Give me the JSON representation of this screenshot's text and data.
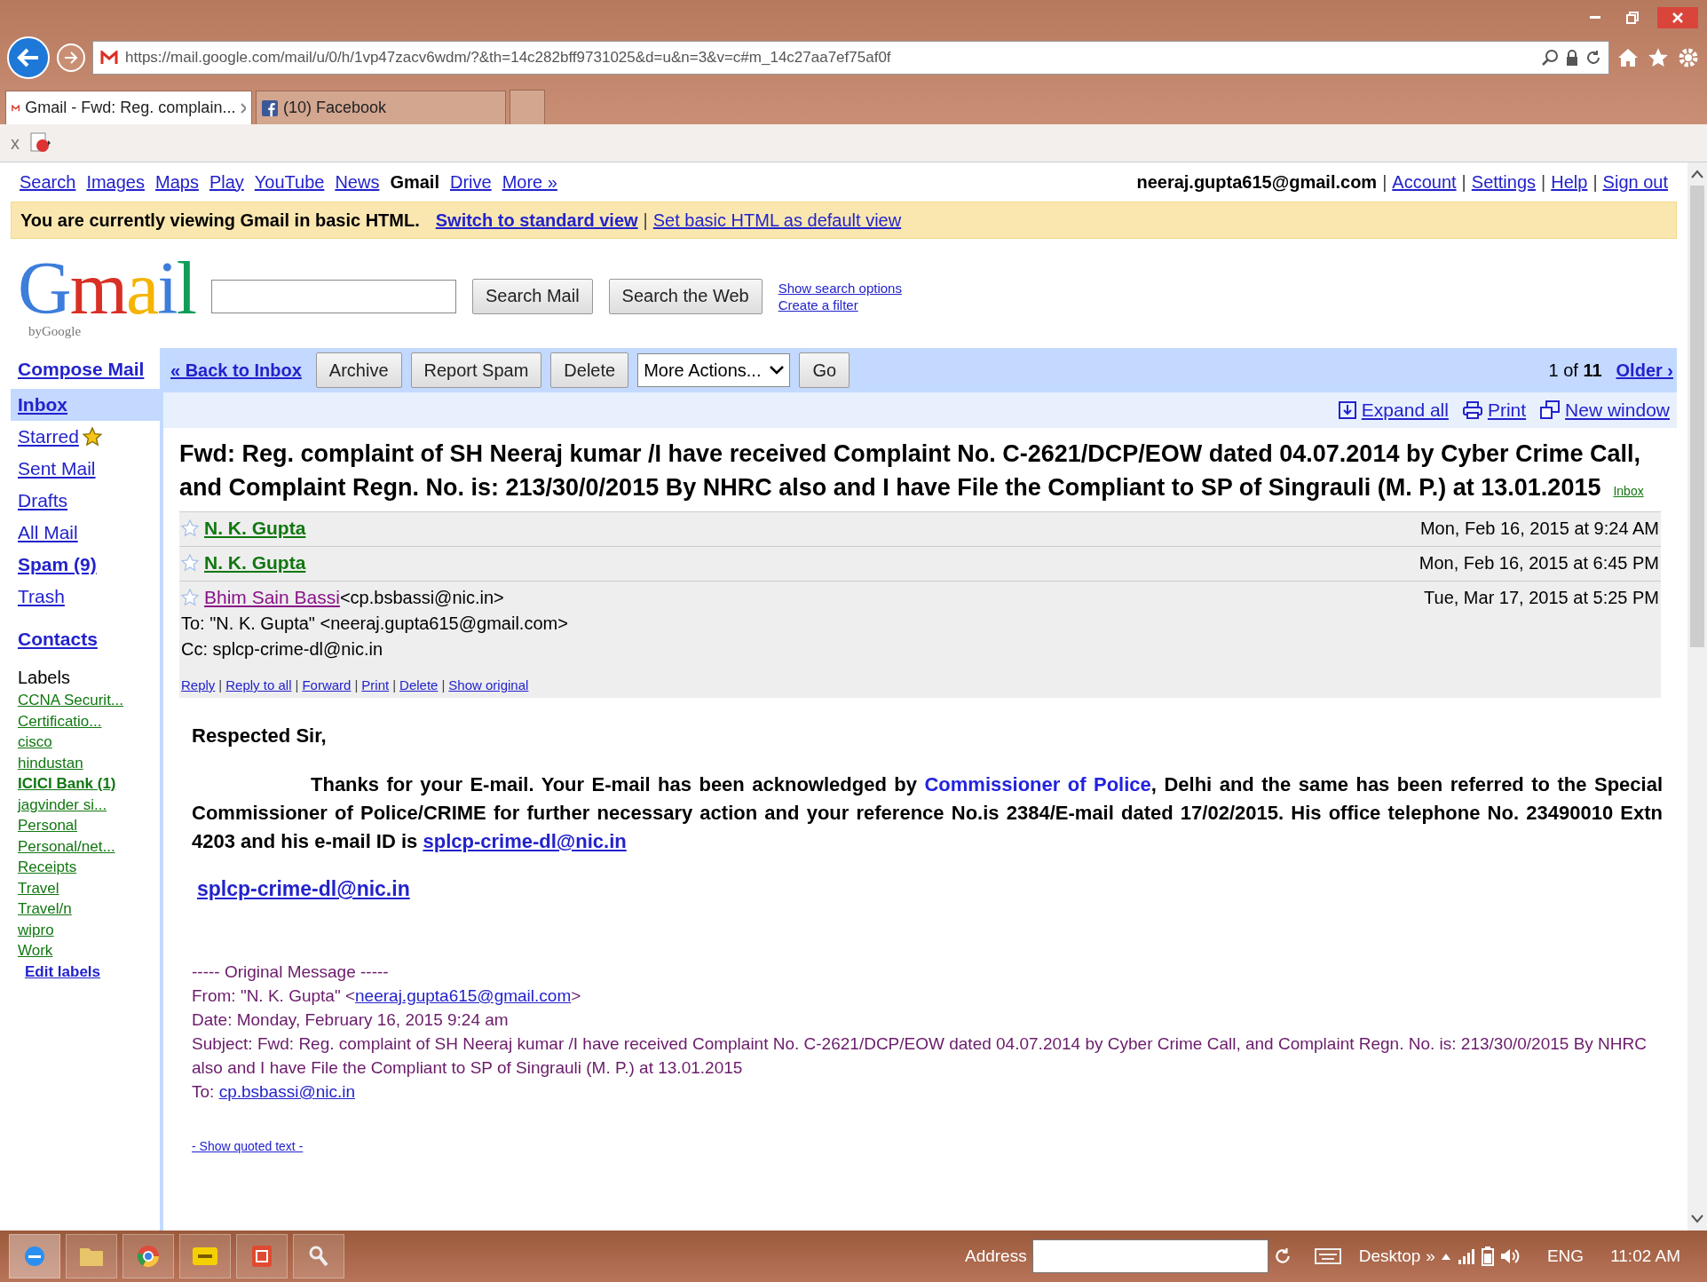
{
  "browser": {
    "url": "https://mail.google.com/mail/u/0/h/1vp47zacv6wdm/?&th=14c282bff9731025&d=u&n=3&v=c#m_14c27aa7ef75af0f",
    "tabs": [
      {
        "label": "Gmail - Fwd: Reg. complain...",
        "kind": "gmail",
        "selected": true
      },
      {
        "label": "(10) Facebook",
        "kind": "facebook",
        "selected": false
      }
    ],
    "toolbar_close": "x"
  },
  "gbar": {
    "links": [
      {
        "label": "Search",
        "selected": false
      },
      {
        "label": "Images",
        "selected": false
      },
      {
        "label": "Maps",
        "selected": false
      },
      {
        "label": "Play",
        "selected": false
      },
      {
        "label": "YouTube",
        "selected": false
      },
      {
        "label": "News",
        "selected": false
      },
      {
        "label": "Gmail",
        "selected": true
      },
      {
        "label": "Drive",
        "selected": false
      },
      {
        "label": "More »",
        "selected": false
      }
    ],
    "account": "neeraj.gupta615@gmail.com",
    "separator": "|",
    "account_links": [
      "Account",
      "Settings",
      "Help",
      "Sign out"
    ]
  },
  "notice": {
    "text": "You are currently viewing Gmail in basic HTML.",
    "separator": "|",
    "links": [
      {
        "label": "Switch to standard view",
        "bold": true
      },
      {
        "label": "Set basic HTML as default view",
        "bold": false
      }
    ]
  },
  "logo": {
    "text": "Gmail",
    "byline": "byGoogle"
  },
  "search": {
    "buttons": [
      "Search Mail",
      "Search the Web"
    ],
    "links": [
      "Show search options",
      "Create a filter"
    ]
  },
  "sidebar": {
    "compose": "Compose Mail",
    "items": [
      {
        "label": "Inbox",
        "selected": true,
        "starred": false,
        "bold": true
      },
      {
        "label": "Starred",
        "selected": false,
        "starred": true,
        "bold": false
      },
      {
        "label": "Sent Mail",
        "selected": false,
        "starred": false,
        "bold": false
      },
      {
        "label": "Drafts",
        "selected": false,
        "starred": false,
        "bold": false
      },
      {
        "label": "All Mail",
        "selected": false,
        "starred": false,
        "bold": false
      },
      {
        "label": "Spam (9)",
        "selected": false,
        "starred": false,
        "bold": true
      },
      {
        "label": "Trash",
        "selected": false,
        "starred": false,
        "bold": false
      }
    ],
    "contacts": "Contacts",
    "labels_heading": "Labels",
    "labels": [
      {
        "label": "CCNA Securit...",
        "bold": false
      },
      {
        "label": "Certificatio...",
        "bold": false
      },
      {
        "label": "cisco",
        "bold": false
      },
      {
        "label": "hindustan",
        "bold": false
      },
      {
        "label": "ICICI Bank (1)",
        "bold": true
      },
      {
        "label": "jagvinder si...",
        "bold": false
      },
      {
        "label": "Personal",
        "bold": false
      },
      {
        "label": "Personal/net...",
        "bold": false
      },
      {
        "label": "Receipts",
        "bold": false
      },
      {
        "label": "Travel",
        "bold": false
      },
      {
        "label": "Travel/n",
        "bold": false
      },
      {
        "label": "wipro",
        "bold": false
      },
      {
        "label": "Work",
        "bold": false
      }
    ],
    "edit_labels": "Edit labels"
  },
  "actions": {
    "back": "« Back to Inbox",
    "buttons": [
      "Archive",
      "Report Spam",
      "Delete"
    ],
    "select": "More Actions...",
    "go": "Go",
    "pager_bold": "11",
    "pager_prefix": "1 of ",
    "older": "Older ›"
  },
  "tools": [
    {
      "label": "Expand all",
      "kind": "expand"
    },
    {
      "label": "Print",
      "kind": "print"
    },
    {
      "label": "New window",
      "kind": "window"
    }
  ],
  "subject": {
    "text": "Fwd: Reg. complaint of SH Neeraj kumar /I have received Complaint No. C-2621/DCP/EOW dated 04.07.2014 by Cyber Crime Call, and Complaint Regn. No. is: 213/30/0/2015 By NHRC also and I have File the Compliant to SP of Singrauli (M. P.) at 13.01.2015",
    "label": "Inbox"
  },
  "messages": [
    {
      "sender": "N. K. Gupta",
      "date": "Mon, Feb 16, 2015 at 9:24 AM",
      "expanded": false,
      "starred": false
    },
    {
      "sender": "N. K. Gupta",
      "date": "Mon, Feb 16, 2015 at 6:45 PM",
      "expanded": false,
      "starred": false
    },
    {
      "sender": "Bhim Sain Bassi",
      "address": "<cp.bsbassi@nic.in>",
      "date": "Tue, Mar 17, 2015 at 5:25 PM",
      "expanded": true,
      "starred": false
    }
  ],
  "message_detail": {
    "to": "To: \"N. K. Gupta\" <neeraj.gupta615@gmail.com>",
    "cc": "Cc: splcp-crime-dl@nic.in",
    "separator": "|",
    "links": [
      "Reply",
      "Reply to all",
      "Forward",
      "Print",
      "Delete",
      "Show original"
    ]
  },
  "body": {
    "greeting": "Respected Sir,",
    "paragraph": [
      {
        "kind": "text",
        "text": "Thanks for your E-mail.  Your E-mail has been acknowledged by "
      },
      {
        "kind": "highlight",
        "text": "Commissioner of Police"
      },
      {
        "kind": "text",
        "text": ", Delhi and the same has been referred to the Special Commissioner of Police/CRIME for further necessary action and your reference No.is 2384/E-mail dated 17/02/2015.  His office telephone No. 23490010 Extn 4203 and his e-mail ID is "
      },
      {
        "kind": "link",
        "text": "splcp-crime-dl@nic.in"
      }
    ],
    "email_link": "splcp-crime-dl@nic.in",
    "original": {
      "heading": "----- Original Message -----",
      "from": [
        {
          "kind": "text",
          "text": "From: \"N. K. Gupta\" <"
        },
        {
          "kind": "link",
          "text": "neeraj.gupta615@gmail.com"
        },
        {
          "kind": "text",
          "text": ">"
        }
      ],
      "date": "Date: Monday, February 16, 2015 9:24 am",
      "subject": "Subject: Fwd: Reg. complaint of SH Neeraj kumar /I have received Complaint No. C-2621/DCP/EOW dated 04.07.2014 by Cyber Crime Call, and Complaint Regn. No. is: 213/30/0/2015 By NHRC also and I have File the Compliant to SP of Singrauli (M. P.) at 13.01.2015",
      "to_prefix": "To: ",
      "to": "cp.bsbassi@nic.in"
    },
    "show_quoted": "- Show quoted text -"
  },
  "taskbar": {
    "apps": [
      {
        "kind": "ie",
        "selected": true
      },
      {
        "kind": "folder",
        "selected": false
      },
      {
        "kind": "chrome",
        "selected": false
      },
      {
        "kind": "notes",
        "selected": false
      },
      {
        "kind": "acrobat",
        "selected": false
      },
      {
        "kind": "magnifier",
        "selected": false
      }
    ],
    "address_label": "Address",
    "desktop": "Desktop",
    "chevron": "»",
    "language": "ENG",
    "time": "11:02 AM"
  }
}
